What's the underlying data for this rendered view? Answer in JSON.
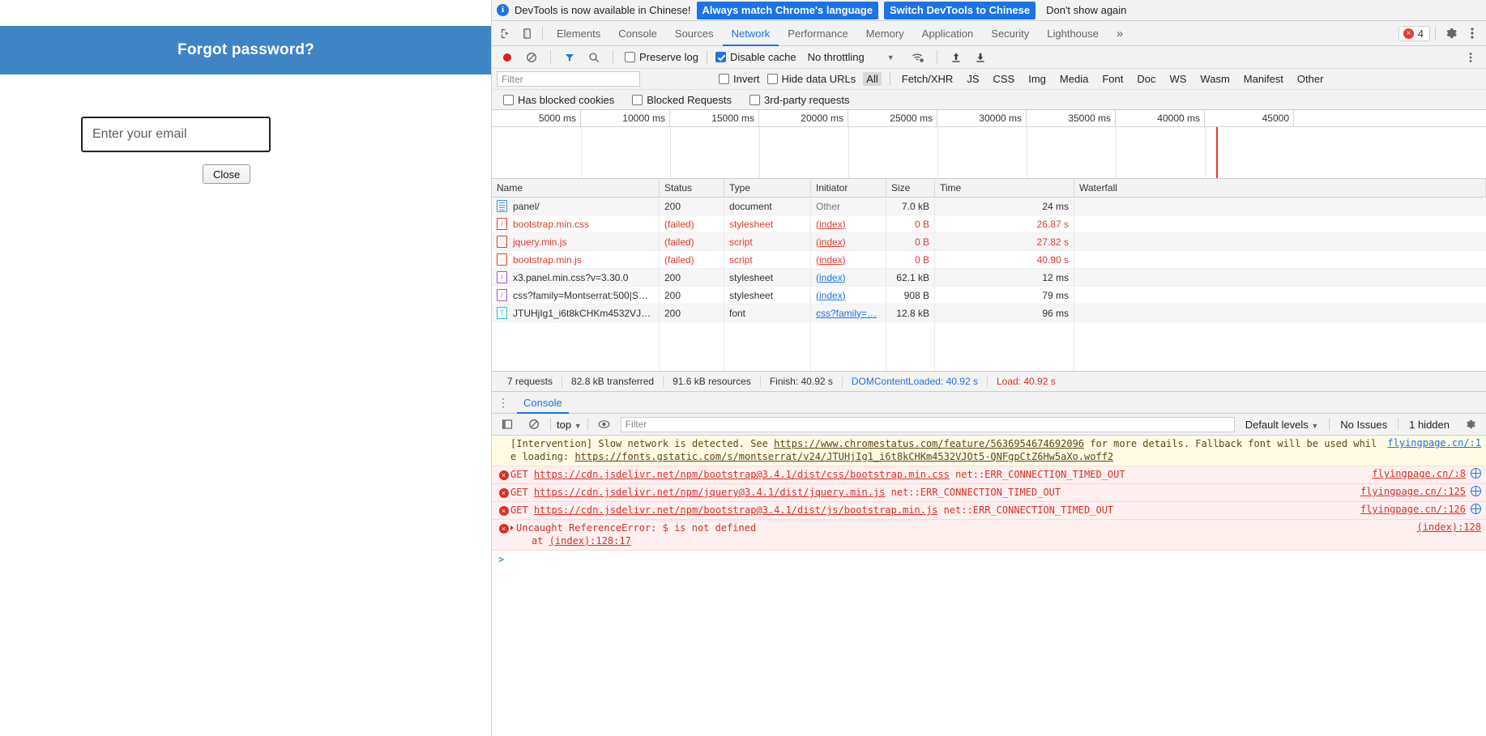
{
  "page": {
    "header_title": "Forgot password?",
    "email_placeholder": "Enter your email",
    "email_value": "",
    "close_label": "Close"
  },
  "infobar": {
    "message": "DevTools is now available in Chinese!",
    "primary_button": "Always match Chrome's language",
    "secondary_button": "Switch DevTools to Chinese",
    "dismiss_button": "Don't show again",
    "accent": "#1a73e8"
  },
  "tabbar": {
    "tabs": [
      "Elements",
      "Console",
      "Sources",
      "Network",
      "Performance",
      "Memory",
      "Application",
      "Security",
      "Lighthouse"
    ],
    "active_tab": "Network",
    "overflow_label": "»",
    "error_count": "4",
    "settings_icon": "gear-icon",
    "menu_icon": "kebab-menu-icon"
  },
  "netbar": {
    "record_icon": "record-icon",
    "clear_icon": "clear-icon",
    "filter_icon": "funnel-icon",
    "search_icon": "search-icon",
    "preserve_log_label": "Preserve log",
    "preserve_log_checked": false,
    "disable_cache_label": "Disable cache",
    "disable_cache_checked": true,
    "throttling_value": "No throttling",
    "wifi_icon": "wifi-settings-icon",
    "import_icon": "upload-icon",
    "export_icon": "download-icon"
  },
  "filterbar": {
    "filter_placeholder": "Filter",
    "filter_value": "",
    "invert_label": "Invert",
    "invert_checked": false,
    "hide_data_urls_label": "Hide data URLs",
    "hide_data_urls_checked": false,
    "types": [
      "All",
      "Fetch/XHR",
      "JS",
      "CSS",
      "Img",
      "Media",
      "Font",
      "Doc",
      "WS",
      "Wasm",
      "Manifest",
      "Other"
    ],
    "active_type": "All"
  },
  "cookiebar": {
    "has_blocked_cookies": "Has blocked cookies",
    "has_blocked_cookies_checked": false,
    "blocked_requests": "Blocked Requests",
    "blocked_requests_checked": false,
    "third_party_requests": "3rd-party requests",
    "third_party_requests_checked": false
  },
  "timeline": {
    "ticks": [
      "5000 ms",
      "10000 ms",
      "15000 ms",
      "20000 ms",
      "25000 ms",
      "30000 ms",
      "35000 ms",
      "40000 ms",
      "45000"
    ]
  },
  "table": {
    "columns": [
      "Name",
      "Status",
      "Type",
      "Initiator",
      "Size",
      "Time",
      "Waterfall"
    ],
    "rows": [
      {
        "icon": "document-icon",
        "name": "panel/",
        "status": "200",
        "type": "document",
        "initiator": "Other",
        "initiator_link": false,
        "size": "7.0 kB",
        "time": "24 ms",
        "failed": false,
        "wf_left": 0.5,
        "wf_width": 0.4,
        "wf_color": "#4a90d9"
      },
      {
        "icon": "stylesheet-failed-icon",
        "name": "bootstrap.min.css",
        "status": "(failed)",
        "type": "stylesheet",
        "initiator": "(index)",
        "initiator_link": true,
        "size": "0 B",
        "time": "26.87 s",
        "failed": true,
        "wf_left": 0,
        "wf_width": 0
      },
      {
        "icon": "script-failed-icon",
        "name": "jquery.min.js",
        "status": "(failed)",
        "type": "script",
        "initiator": "(index)",
        "initiator_link": true,
        "size": "0 B",
        "time": "27.82 s",
        "failed": true,
        "wf_left": 0,
        "wf_width": 0
      },
      {
        "icon": "script-failed-icon",
        "name": "bootstrap.min.js",
        "status": "(failed)",
        "type": "script",
        "initiator": "(index)",
        "initiator_link": true,
        "size": "0 B",
        "time": "40.90 s",
        "failed": true,
        "wf_left": 0,
        "wf_width": 0
      },
      {
        "icon": "stylesheet-icon",
        "name": "x3.panel.min.css?v=3.30.0",
        "status": "200",
        "type": "stylesheet",
        "initiator": "(index)",
        "initiator_link": true,
        "size": "62.1 kB",
        "time": "12 ms",
        "failed": false,
        "wf_left": 0.5,
        "wf_width": 0.3,
        "wf_color": "#6aaee8"
      },
      {
        "icon": "stylesheet-icon",
        "name": "css?family=Montserrat:500|S…",
        "status": "200",
        "type": "stylesheet",
        "initiator": "(index)",
        "initiator_link": true,
        "size": "908 B",
        "time": "79 ms",
        "failed": false,
        "wf_left": 0.5,
        "wf_width": 0.45,
        "wf_color": "#6aaee8"
      },
      {
        "icon": "font-icon",
        "name": "JTUHjIg1_i6t8kCHKm4532VJ…",
        "status": "200",
        "type": "font",
        "initiator": "css?family=…",
        "initiator_link": true,
        "size": "12.8 kB",
        "time": "96 ms",
        "failed": false,
        "wf_left": 21.5,
        "wf_width": 25,
        "wf_color": "#b8d5f0"
      }
    ]
  },
  "summary": {
    "requests": "7 requests",
    "transferred": "82.8 kB transferred",
    "resources": "91.6 kB resources",
    "finish": "Finish: 40.92 s",
    "dom_content_loaded": "DOMContentLoaded: 40.92 s",
    "load": "Load: 40.92 s",
    "blue": "#1a73e8",
    "red": "#d93025"
  },
  "drawer": {
    "tab_label": "Console",
    "execute_icon": "sidebar-toggle-icon",
    "clear_icon": "clear-console-icon",
    "context": "top",
    "eye_icon": "live-expression-icon",
    "filter_placeholder": "Filter",
    "filter_value": "",
    "levels": "Default levels",
    "issues": "No Issues",
    "hidden": "1 hidden",
    "settings_icon": "console-settings-icon"
  },
  "console_messages": [
    {
      "level": "warn",
      "text_parts": [
        {
          "t": "[Intervention] Slow network is detected. See ",
          "link": false
        },
        {
          "t": "https://www.chromestatus.com/feature/5636954674692096",
          "link": true
        },
        {
          "t": " for more details. Fallback font will be used while loading: ",
          "link": false
        },
        {
          "t": "https://fonts.gstatic.com/s/montserrat/v24/JTUHjIg1_i6t8kCHKm4532VJOt5-QNFgpCtZ6Hw5aXo.woff2",
          "link": true
        }
      ],
      "source": "flyingpage.cn/:1",
      "has_globe": false
    },
    {
      "level": "err",
      "text_parts": [
        {
          "t": "GET ",
          "link": false
        },
        {
          "t": "https://cdn.jsdelivr.net/npm/bootstrap@3.4.1/dist/css/bootstrap.min.css",
          "link": true
        },
        {
          "t": " net::ERR_CONNECTION_TIMED_OUT",
          "link": false
        }
      ],
      "source": "flyingpage.cn/:8",
      "has_globe": true
    },
    {
      "level": "err",
      "text_parts": [
        {
          "t": "GET ",
          "link": false
        },
        {
          "t": "https://cdn.jsdelivr.net/npm/jquery@3.4.1/dist/jquery.min.js",
          "link": true
        },
        {
          "t": " net::ERR_CONNECTION_TIMED_OUT",
          "link": false
        }
      ],
      "source": "flyingpage.cn/:125",
      "has_globe": true
    },
    {
      "level": "err",
      "text_parts": [
        {
          "t": "GET ",
          "link": false
        },
        {
          "t": "https://cdn.jsdelivr.net/npm/bootstrap@3.4.1/dist/js/bootstrap.min.js",
          "link": true
        },
        {
          "t": " net::ERR_CONNECTION_TIMED_OUT",
          "link": false
        }
      ],
      "source": "flyingpage.cn/:126",
      "has_globe": true
    },
    {
      "level": "err",
      "expandable": true,
      "text_parts": [
        {
          "t": "Uncaught ReferenceError: $ is not defined",
          "link": false
        }
      ],
      "sub_text": "at ",
      "sub_link": "(index):128:17",
      "source": "(index):128",
      "has_globe": false
    }
  ],
  "prompt": ">"
}
